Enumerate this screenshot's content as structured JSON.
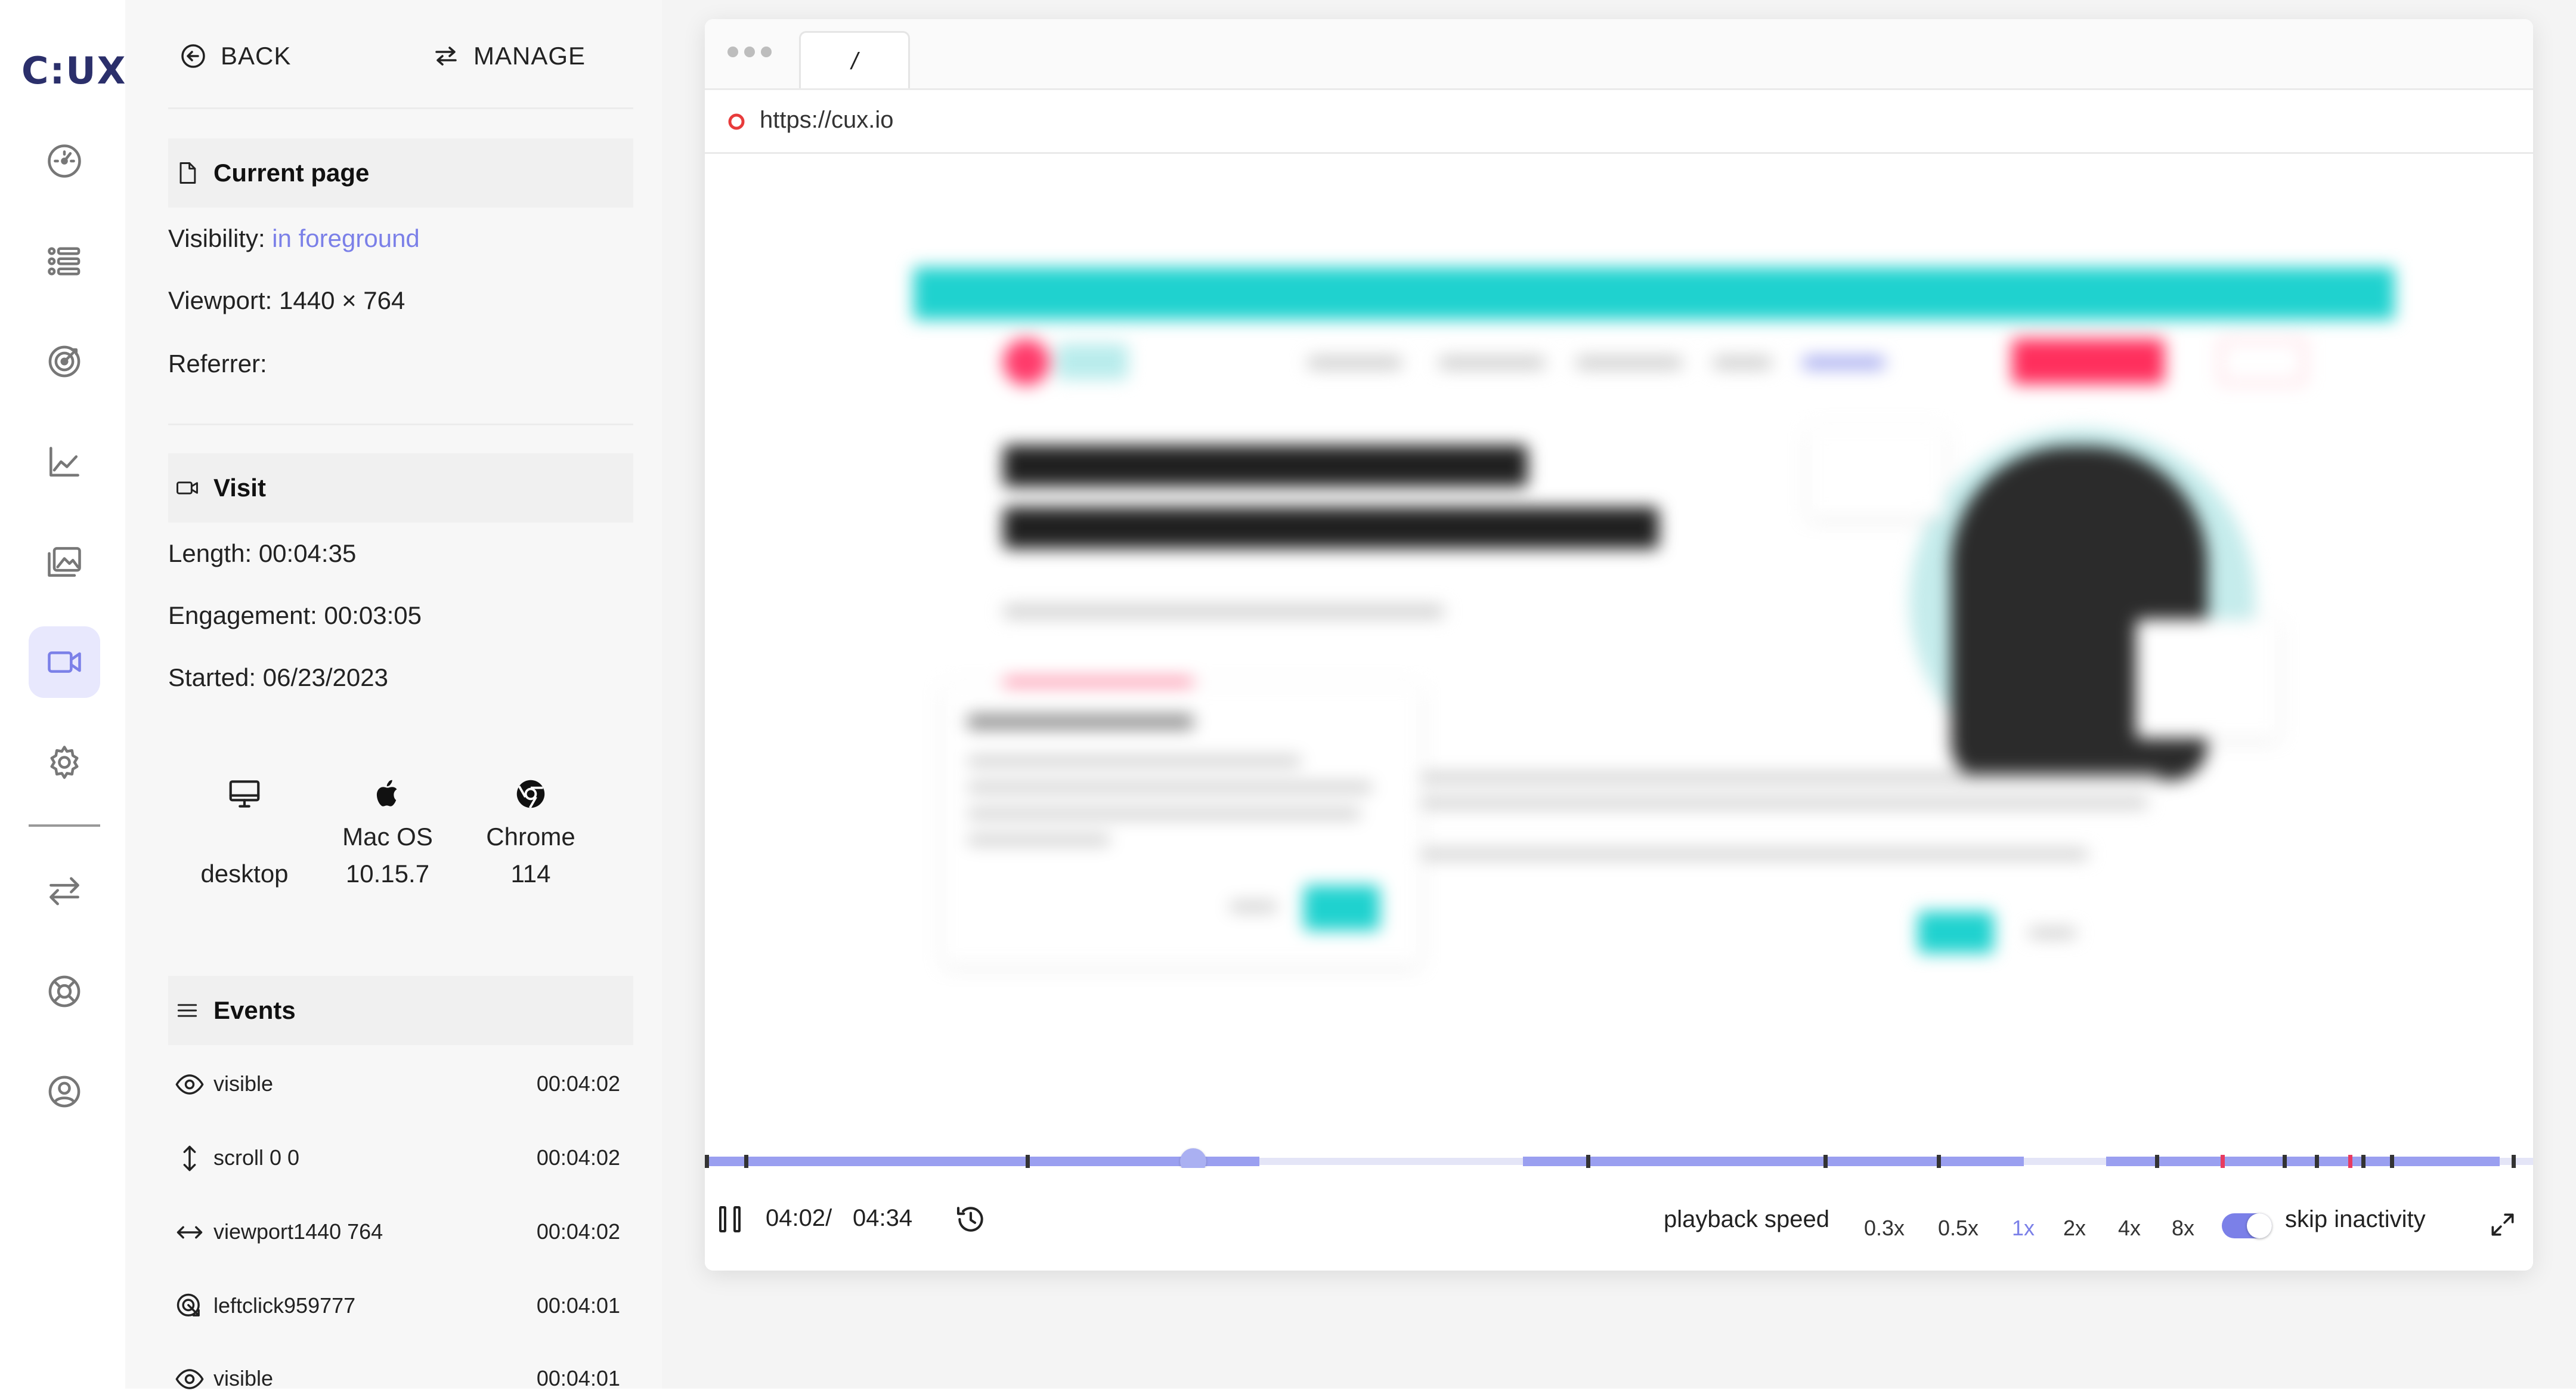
{
  "brand": {
    "logo": "C:UX",
    "accent": "#7b80e8",
    "nav_active_bg": "#e8e8fd"
  },
  "nav": {
    "items": [
      {
        "name": "dashboard-icon"
      },
      {
        "name": "segments-icon"
      },
      {
        "name": "goals-icon"
      },
      {
        "name": "analytics-icon"
      },
      {
        "name": "heatmaps-icon"
      },
      {
        "name": "recordings-icon",
        "active": true
      },
      {
        "name": "settings-icon"
      },
      {
        "name": "switch-icon"
      },
      {
        "name": "help-icon"
      },
      {
        "name": "account-icon"
      }
    ]
  },
  "panel": {
    "back_label": "BACK",
    "manage_label": "MANAGE",
    "current_page": {
      "title": "Current page",
      "visibility_label": "Visibility:",
      "visibility_value": "in foreground",
      "viewport_label": "Viewport:",
      "viewport_value": "1440 × 764",
      "referrer_label": "Referrer:",
      "referrer_value": ""
    },
    "visit": {
      "title": "Visit",
      "length_label": "Length:",
      "length_value": "00:04:35",
      "engagement_label": "Engagement:",
      "engagement_value": "00:03:05",
      "started_label": "Started:",
      "started_value": "06/23/2023"
    },
    "tech": {
      "device": "desktop",
      "os_name": "Mac OS",
      "os_version": "10.15.7",
      "browser_name": "Chrome",
      "browser_version": "114"
    },
    "events": {
      "title": "Events",
      "items": [
        {
          "icon": "eye-icon",
          "name": "visible",
          "time": "00:04:02"
        },
        {
          "icon": "scroll-icon",
          "name": "scroll 0 0",
          "time": "00:04:02"
        },
        {
          "icon": "resize-icon",
          "name": "viewport1440 764",
          "time": "00:04:02"
        },
        {
          "icon": "click-icon",
          "name": "leftclick959777",
          "time": "00:04:01"
        },
        {
          "icon": "eye-icon",
          "name": "visible",
          "time": "00:04:01"
        }
      ]
    }
  },
  "player": {
    "tab_label": "/",
    "url": "https://cux.io",
    "time_current": "04:02/",
    "time_total": "04:34",
    "progress": 0.267,
    "playback_label": "playback speed",
    "speeds": [
      "0.3x",
      "0.5x",
      "1x",
      "2x",
      "4x",
      "8x"
    ],
    "active_speed": "1x",
    "skip_label": "skip inactivity",
    "skip_enabled": true
  }
}
